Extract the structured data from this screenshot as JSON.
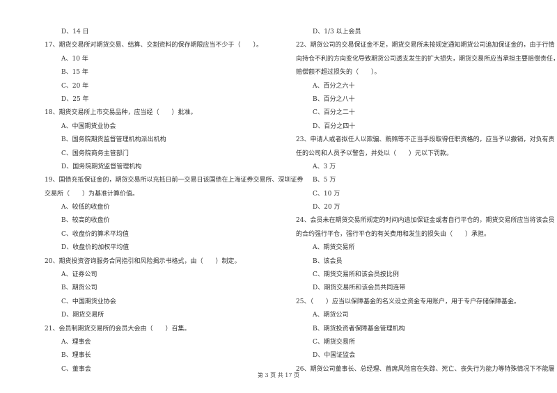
{
  "left_column": [
    {
      "type": "opt",
      "text": "D、14 日"
    },
    {
      "type": "q",
      "text": "17、期货交易所对期货交易、结算、交割资料的保存期限应当不少于（　　）。"
    },
    {
      "type": "opt",
      "text": "A、10 年"
    },
    {
      "type": "opt",
      "text": "B、15 年"
    },
    {
      "type": "opt",
      "text": "C、20 年"
    },
    {
      "type": "opt",
      "text": "D、25 年"
    },
    {
      "type": "q",
      "text": "18、期货交易所上市交易品种，应当经（　　）批准。"
    },
    {
      "type": "opt",
      "text": "A、中国期货业协会"
    },
    {
      "type": "opt",
      "text": "B、国务院期货监督管理机构派出机构"
    },
    {
      "type": "opt",
      "text": "C、国务院商务主管部门"
    },
    {
      "type": "opt",
      "text": "D、国务院期货监督管理机构"
    },
    {
      "type": "q",
      "text": "19、国债充抵保证金的，期货交易所以充抵日前一交易日该国债在上海证券交易所、深圳证券"
    },
    {
      "type": "q",
      "text": "交易所（　　）为基准计算价值。"
    },
    {
      "type": "opt",
      "text": "A、较低的收盘价"
    },
    {
      "type": "opt",
      "text": "B、较高的收盘价"
    },
    {
      "type": "opt",
      "text": "C、收盘价的算术平均值"
    },
    {
      "type": "opt",
      "text": "D、收盘价的加权平均值"
    },
    {
      "type": "q",
      "text": "20、期货投资咨询服务合同指引和风险揭示书格式，由（　　）制定。"
    },
    {
      "type": "opt",
      "text": "A、证券公司"
    },
    {
      "type": "opt",
      "text": "B、期货公司"
    },
    {
      "type": "opt",
      "text": "C、中国期货业协会"
    },
    {
      "type": "opt",
      "text": "D、期货交易所"
    },
    {
      "type": "q",
      "text": "21、会员制期货交易所的会员大会由（　　）召集。"
    },
    {
      "type": "opt",
      "text": "A、理事会"
    },
    {
      "type": "opt",
      "text": "B、理事长"
    },
    {
      "type": "opt",
      "text": "C、董事会"
    }
  ],
  "right_column": [
    {
      "type": "opt",
      "text": "D、1/3 以上会员"
    },
    {
      "type": "q",
      "text": "22、期货公司的交易保证金不足，期货交易所未按规定通知期货公司追加保证金的，由于行情"
    },
    {
      "type": "q",
      "text": "向持仓不利的方向变化导致期货公司透支发生的扩大损失，期货交易所应当承担主要赔偿责任，"
    },
    {
      "type": "q",
      "text": "赔偿额不超过损失的（　　）。"
    },
    {
      "type": "opt",
      "text": "A、百分之六十"
    },
    {
      "type": "opt",
      "text": "B、百分之八十"
    },
    {
      "type": "opt",
      "text": "C、百分之二十"
    },
    {
      "type": "opt",
      "text": "D、百分之四十"
    },
    {
      "type": "q",
      "text": "23、申请人或者拟任人以欺骗、贿赂等不正当手段取得任职资格的，应当予以撤销，对负有责"
    },
    {
      "type": "q",
      "text": "任的公司和人员予以警告，并处以（　　）元以下罚款。"
    },
    {
      "type": "opt",
      "text": "A、3 万"
    },
    {
      "type": "opt",
      "text": "B、5 万"
    },
    {
      "type": "opt",
      "text": "C、10 万"
    },
    {
      "type": "opt",
      "text": "D、20 万"
    },
    {
      "type": "q",
      "text": "24、会员未在期货交易所规定的时间内追加保证金或者自行平仓的，期货交易所应当将该会员"
    },
    {
      "type": "q",
      "text": "的合约强行平仓，强行平仓的有关费用和发生的损失由（　　）承担。"
    },
    {
      "type": "opt",
      "text": "A、期货交易所"
    },
    {
      "type": "opt",
      "text": "B、该会员"
    },
    {
      "type": "opt",
      "text": "C、期货交易所和该会员按比例"
    },
    {
      "type": "opt",
      "text": "D、期货交易所和该会员共同连带"
    },
    {
      "type": "q",
      "text": "25、（　　）应当以保障基金的名义设立资金专用账户，用于专户存储保障基金。"
    },
    {
      "type": "opt",
      "text": "A、期货公司"
    },
    {
      "type": "opt",
      "text": "B、期货投资者保障基金管理机构"
    },
    {
      "type": "opt",
      "text": "C、期货交易所"
    },
    {
      "type": "opt",
      "text": "D、中国证监会"
    },
    {
      "type": "q",
      "text": "26、期货公司董事长、总经理、首席风险官在失踪、死亡、丧失行为能力等特殊情况下不能履"
    }
  ],
  "footer": {
    "page_label": "第 3 页 共 17 页"
  }
}
